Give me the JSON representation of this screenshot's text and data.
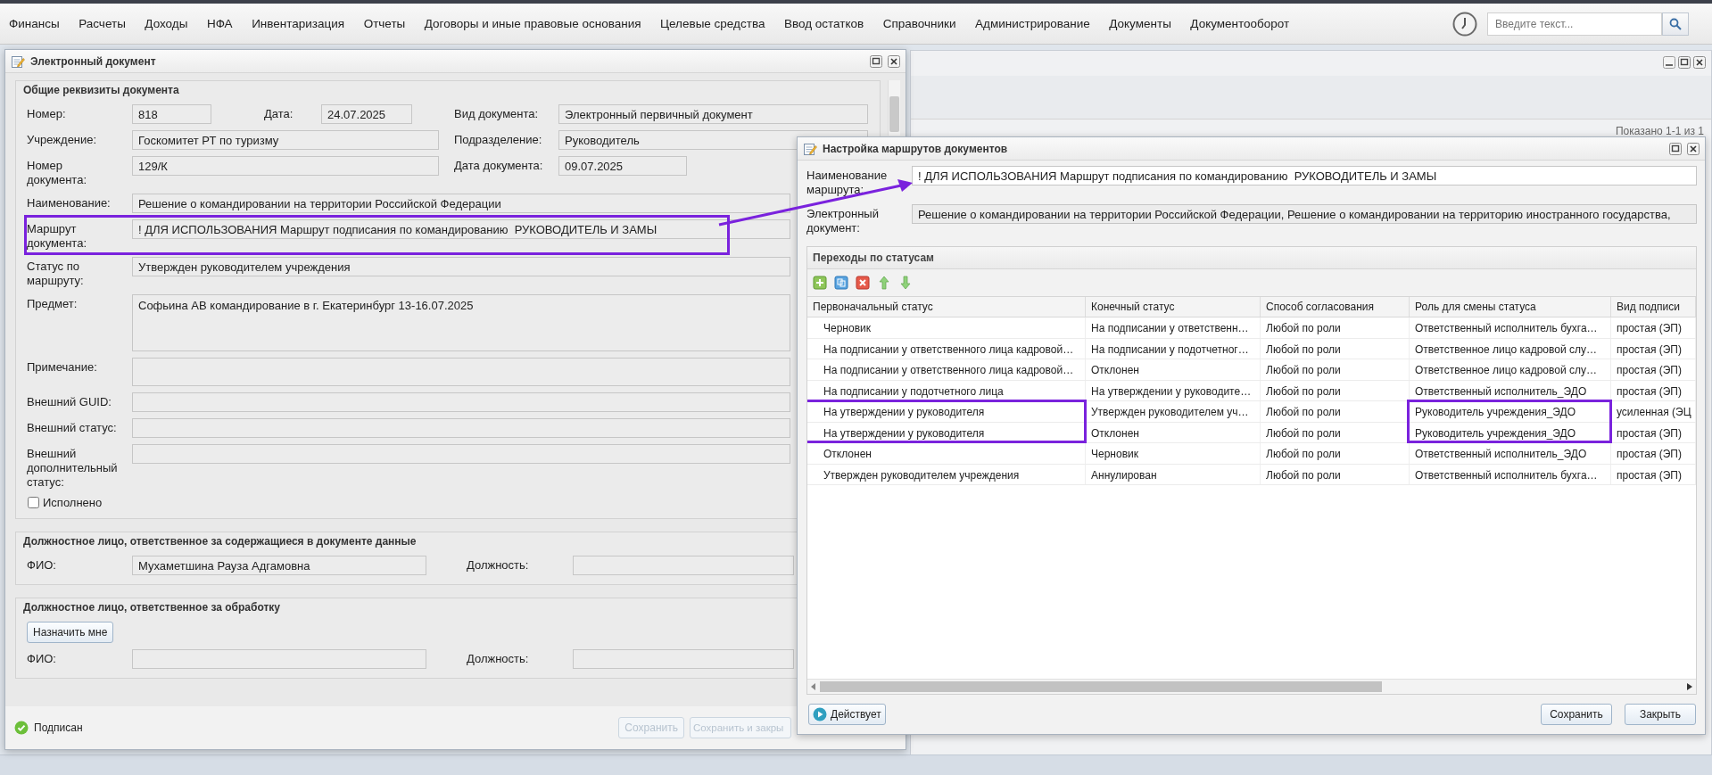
{
  "menu": [
    "Финансы",
    "Расчеты",
    "Доходы",
    "НФА",
    "Инвентаризация",
    "Отчеты",
    "Договоры и иные правовые основания",
    "Целевые средства",
    "Ввод остатков",
    "Справочники",
    "Администрирование",
    "Документы",
    "Документооборот"
  ],
  "search": {
    "placeholder": "Введите текст..."
  },
  "background_window": {
    "status": "Показано 1-1 из 1"
  },
  "document_window": {
    "title": "Электронный документ",
    "general_section": {
      "legend": "Общие реквизиты документа",
      "number": {
        "label": "Номер:",
        "value": "818"
      },
      "date": {
        "label": "Дата:",
        "value": "24.07.2025"
      },
      "doc_type": {
        "label": "Вид документа:",
        "value": "Электронный первичный документ"
      },
      "institution": {
        "label": "Учреждение:",
        "value": "Госкомитет РТ по туризму"
      },
      "division": {
        "label": "Подразделение:",
        "value": "Руководитель"
      },
      "doc_number": {
        "label": "Номер\nдокумента:",
        "value": "129/К"
      },
      "doc_date": {
        "label": "Дата документа:",
        "value": "09.07.2025"
      },
      "wide_fields": [
        {
          "kind": "text",
          "label": "Наименование:",
          "value": "Решение о командировании на территории Российской Федерации",
          "highlighted": false
        },
        {
          "kind": "text",
          "label": "Маршрут\nдокумента:",
          "value": "! ДЛЯ ИСПОЛЬЗОВАНИЯ Маршрут подписания по командированию  РУКОВОДИТЕЛЬ И ЗАМЫ",
          "highlighted": true
        },
        {
          "kind": "text",
          "label": "Статус по\nмаршруту:",
          "value": "Утвержден руководителем учреждения",
          "highlighted": false
        },
        {
          "kind": "textarea",
          "label": "Предмет:",
          "value": "Софьина АВ командирование в г. Екатеринбург 13-16.07.2025",
          "highlighted": false
        },
        {
          "kind": "note",
          "label": "Примечание:",
          "highlighted": false
        },
        {
          "kind": "text",
          "label": "Внешний GUID:",
          "highlighted": false
        },
        {
          "kind": "text",
          "label": "Внешний статус:",
          "highlighted": false
        },
        {
          "kind": "text",
          "label": "Внешний\nдополнительный\nстатус:",
          "highlighted": false
        }
      ],
      "done_checkbox": {
        "label": "Исполнено",
        "checked": false
      }
    },
    "responsible_section": {
      "legend": "Должностное лицо, ответственное за содержащиеся в документе данные",
      "fio": {
        "label": "ФИО:",
        "value": "Мухаметшина Рауза Адгамовна"
      },
      "position": {
        "label": "Должность:"
      }
    },
    "processing_section": {
      "legend": "Должностное лицо, ответственное за обработку",
      "assign_button": "Назначить мне",
      "fio": {
        "label": "ФИО:"
      },
      "position": {
        "label": "Должность:"
      }
    },
    "status": "Подписан",
    "buttons": [
      {
        "label": "Сохранить",
        "disabled": true
      },
      {
        "label": "Сохранить и закры",
        "disabled": true
      }
    ]
  },
  "routes_window": {
    "title": "Настройка маршрутов документов",
    "name_field": {
      "label": "Наименование\nмаршрута:",
      "value": "! ДЛЯ ИСПОЛЬЗОВАНИЯ Маршрут подписания по командированию  РУКОВОДИТЕЛЬ И ЗАМЫ"
    },
    "document_field": {
      "label": "Электронный\nдокумент:",
      "value": "Решение о командировании на территории Российской Федерации, Решение о командировании на территорию иностранного государства,"
    },
    "transitions": {
      "title": "Переходы по статусам",
      "columns": [
        "Первоначальный статус",
        "Конечный статус",
        "Способ согласования",
        "Роль для смены статуса",
        "Вид подписи"
      ],
      "rows": [
        {
          "cells": [
            "Черновик",
            "На подписании у ответственн…",
            "Любой по роли",
            "Ответственный исполнитель бухга…",
            "простая (ЭП)"
          ],
          "highlighted": false
        },
        {
          "cells": [
            "На подписании у ответственного лица кадровой…",
            "На подписании у подотчетног…",
            "Любой по роли",
            "Ответственное лицо кадровой слу…",
            "простая (ЭП)"
          ],
          "highlighted": false
        },
        {
          "cells": [
            "На подписании у ответственного лица кадровой…",
            "Отклонен",
            "Любой по роли",
            "Ответственное лицо кадровой слу…",
            "простая (ЭП)"
          ],
          "highlighted": false
        },
        {
          "cells": [
            "На подписании у подотчетного лица",
            "На утверждении у руководите…",
            "Любой по роли",
            "Ответственный исполнитель_ЭДО",
            "простая (ЭП)"
          ],
          "highlighted": false
        },
        {
          "cells": [
            "На утверждении у руководителя",
            "Утвержден руководителем уч…",
            "Любой по роли",
            "Руководитель учреждения_ЭДО",
            "усиленная (ЭЦ"
          ],
          "highlighted": true
        },
        {
          "cells": [
            "На утверждении у руководителя",
            "Отклонен",
            "Любой по роли",
            "Руководитель учреждения_ЭДО",
            "простая (ЭП)"
          ],
          "highlighted": true
        },
        {
          "cells": [
            "Отклонен",
            "Черновик",
            "Любой по роли",
            "Ответственный исполнитель_ЭДО",
            "простая (ЭП)"
          ],
          "highlighted": false
        },
        {
          "cells": [
            "Утвержден руководителем учреждения",
            "Аннулирован",
            "Любой по роли",
            "Ответственный исполнитель бухга…",
            "простая (ЭП)"
          ],
          "highlighted": false
        }
      ]
    },
    "active_button": "Действует",
    "buttons": [
      "Сохранить",
      "Закрыть"
    ]
  }
}
